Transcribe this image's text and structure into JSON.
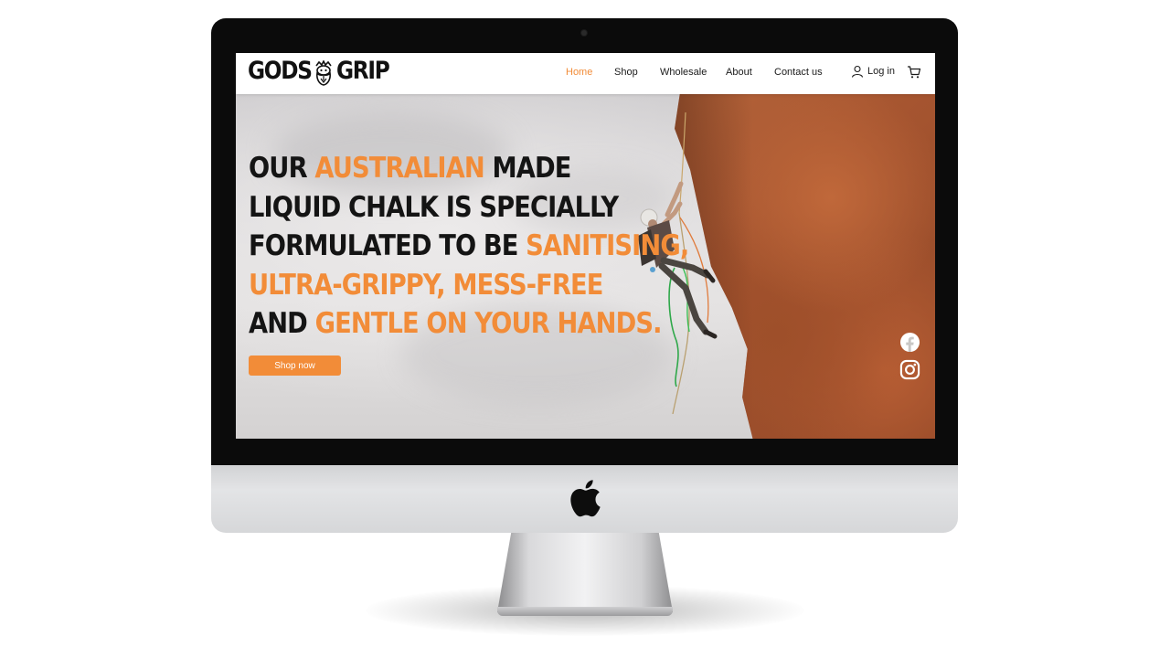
{
  "brand": {
    "word_left": "GODS",
    "word_right": "GRIP",
    "icon": "bearded-face-logo"
  },
  "nav": {
    "links": [
      {
        "label": "Home",
        "active": true
      },
      {
        "label": "Shop",
        "active": false
      },
      {
        "label": "Wholesale",
        "active": false
      },
      {
        "label": "About",
        "active": false
      },
      {
        "label": "Contact us",
        "active": false
      }
    ],
    "login_label": "Log in",
    "login_icon": "user-icon",
    "cart_icon": "cart-icon"
  },
  "hero": {
    "headline_lines": [
      [
        {
          "text": "OUR ",
          "accent": false
        },
        {
          "text": "AUSTRALIAN",
          "accent": true
        },
        {
          "text": " MADE",
          "accent": false
        }
      ],
      [
        {
          "text": "LIQUID CHALK IS SPECIALLY",
          "accent": false
        }
      ],
      [
        {
          "text": "FORMULATED TO BE ",
          "accent": false
        },
        {
          "text": "SANITISING,",
          "accent": true
        }
      ],
      [
        {
          "text": "ULTRA-GRIPPY, MESS-FREE",
          "accent": true
        }
      ],
      [
        {
          "text": "AND ",
          "accent": false
        },
        {
          "text": "GENTLE ON YOUR HANDS.",
          "accent": true
        }
      ]
    ],
    "cta_label": "Shop now",
    "image": "rock-climber-on-red-cliff",
    "social_icons": [
      "facebook-icon",
      "instagram-icon"
    ]
  },
  "device": {
    "frame": "imac-mockup",
    "logo_icon": "apple-logo-icon"
  },
  "colors": {
    "accent": "#f28c38",
    "text": "#141414",
    "nav_bg": "#ffffff"
  }
}
